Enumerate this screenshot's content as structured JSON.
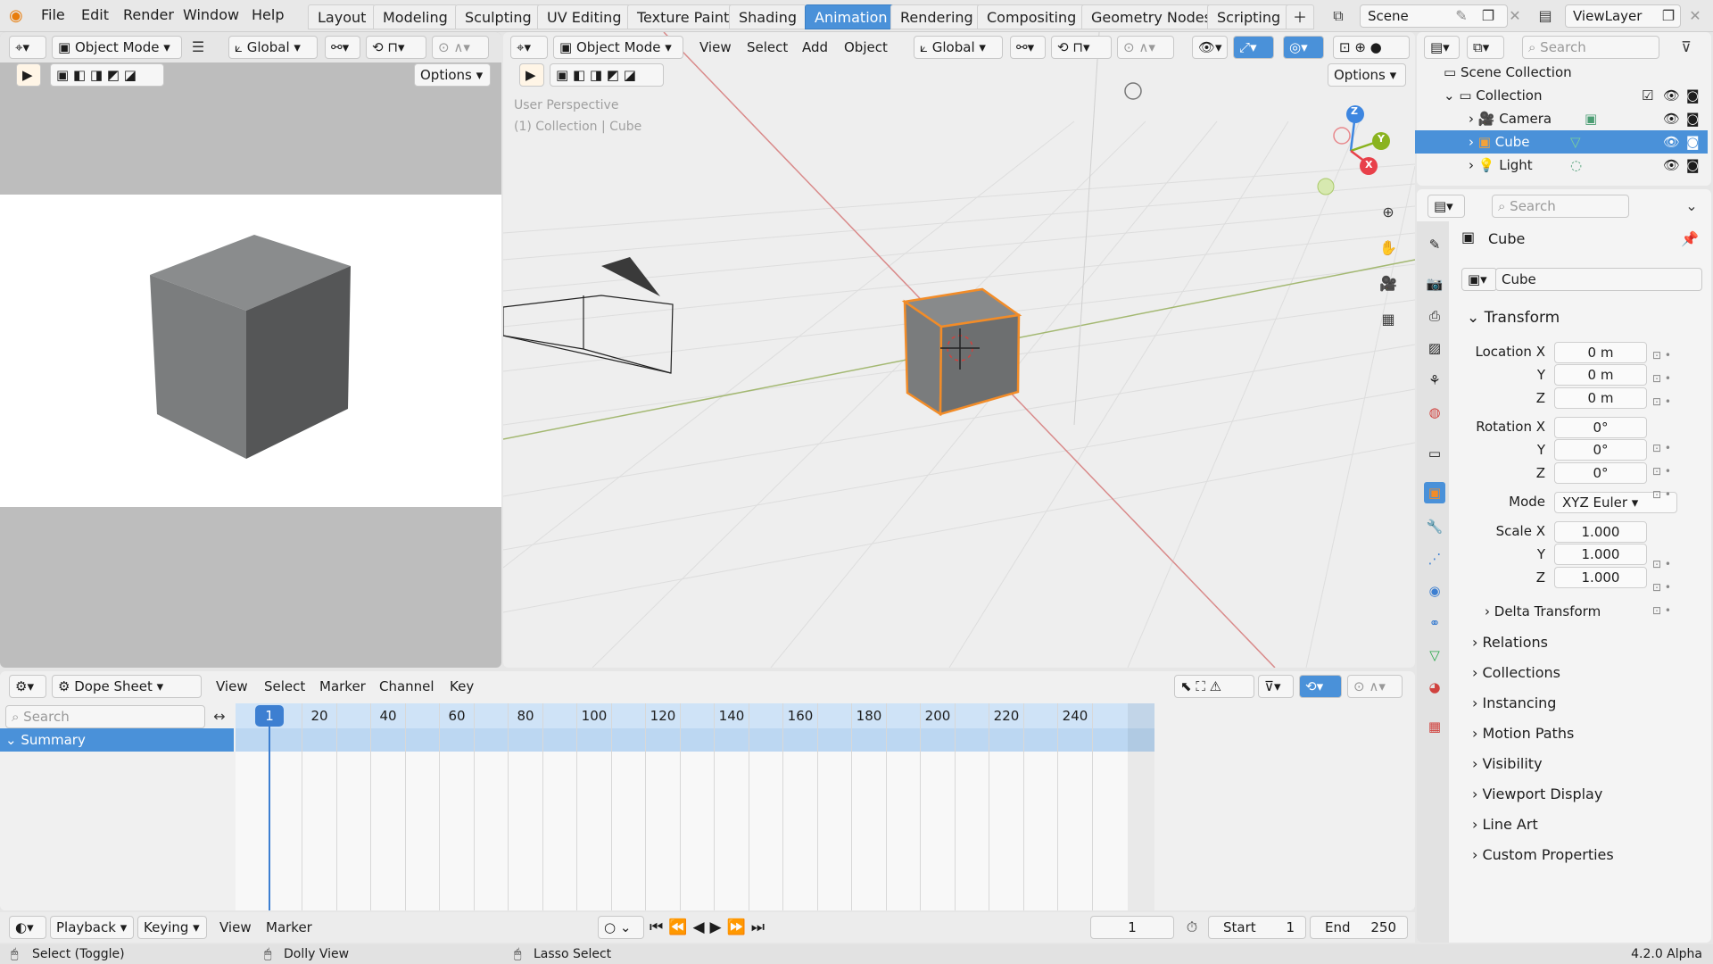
{
  "topbar": {
    "menus": [
      "File",
      "Edit",
      "Render",
      "Window",
      "Help"
    ],
    "workspaces": [
      "Layout",
      "Modeling",
      "Sculpting",
      "UV Editing",
      "Texture Paint",
      "Shading",
      "Animation",
      "Rendering",
      "Compositing",
      "Geometry Nodes",
      "Scripting"
    ],
    "active_workspace": "Animation",
    "scene": "Scene",
    "view_layer": "ViewLayer"
  },
  "camera_view": {
    "mode": "Object Mode",
    "orientation": "Global",
    "options": "Options"
  },
  "viewport": {
    "mode": "Object Mode",
    "menus": [
      "View",
      "Select",
      "Add",
      "Object"
    ],
    "orientation": "Global",
    "options": "Options",
    "overlay_line1": "User Perspective",
    "overlay_line2": "(1) Collection | Cube",
    "gizmo": {
      "x": "X",
      "y": "Y",
      "z": "Z"
    }
  },
  "outliner": {
    "search_placeholder": "Search",
    "scene_collection": "Scene Collection",
    "collection": "Collection",
    "items": [
      {
        "name": "Camera",
        "selected": false
      },
      {
        "name": "Cube",
        "selected": true
      },
      {
        "name": "Light",
        "selected": false
      }
    ]
  },
  "properties": {
    "search_placeholder": "Search",
    "object_name": "Cube",
    "data_name": "Cube",
    "transform_title": "Transform",
    "location": {
      "label": "Location X",
      "x": "0 m",
      "y": "0 m",
      "z": "0 m"
    },
    "rotation": {
      "label": "Rotation X",
      "x": "0°",
      "y": "0°",
      "z": "0°"
    },
    "mode_label": "Mode",
    "mode_value": "XYZ Euler",
    "scale": {
      "label": "Scale X",
      "x": "1.000",
      "y": "1.000",
      "z": "1.000"
    },
    "axis_y": "Y",
    "axis_z": "Z",
    "delta_transform": "Delta Transform",
    "panels": [
      "Relations",
      "Collections",
      "Instancing",
      "Motion Paths",
      "Visibility",
      "Viewport Display",
      "Line Art",
      "Custom Properties"
    ]
  },
  "dopesheet": {
    "editor": "Dope Sheet",
    "menus": [
      "View",
      "Select",
      "Marker",
      "Channel",
      "Key"
    ],
    "search_placeholder": "Search",
    "summary": "Summary",
    "current_frame": "1",
    "ticks": [
      "20",
      "40",
      "60",
      "80",
      "100",
      "120",
      "140",
      "160",
      "180",
      "200",
      "220",
      "240"
    ]
  },
  "timeline": {
    "playback": "Playback",
    "keying": "Keying",
    "view": "View",
    "marker": "Marker",
    "frame": "1",
    "start_label": "Start",
    "start": "1",
    "end_label": "End",
    "end": "250"
  },
  "statusbar": {
    "select": "Select (Toggle)",
    "dolly": "Dolly View",
    "lasso": "Lasso Select",
    "version": "4.2.0 Alpha"
  },
  "colors": {
    "accent": "#4a91d9",
    "selection": "#f28c28",
    "x_axis": "#e8404a",
    "y_axis": "#8ab31f",
    "z_axis": "#3d86e0"
  }
}
